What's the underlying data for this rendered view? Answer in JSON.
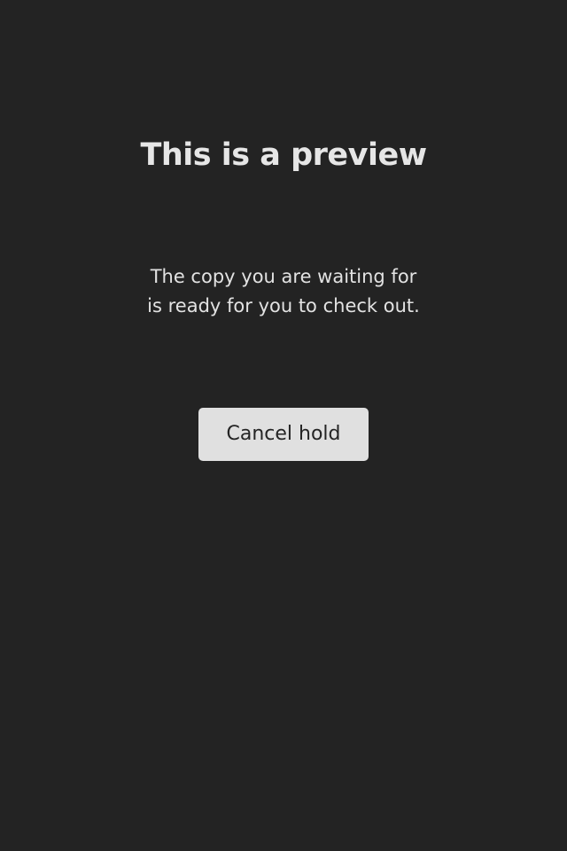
{
  "preview": {
    "title": "This is a preview",
    "message_line1": "The copy you are waiting for",
    "message_line2": "is ready for you to check out.",
    "cancel_label": "Cancel hold"
  },
  "colors": {
    "background": "#232323",
    "text": "#e6e6e6",
    "button_background": "#e0e0e0",
    "button_text": "#242424"
  }
}
